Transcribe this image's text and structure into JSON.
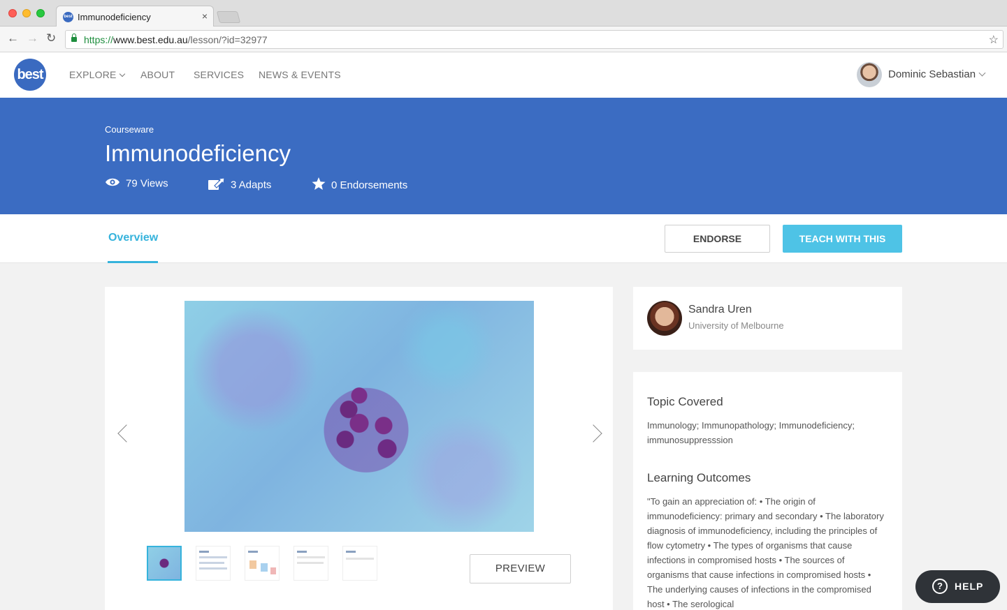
{
  "browser": {
    "tab_title": "Immunodeficiency",
    "tab_close": "×",
    "url_scheme": "https://",
    "url_host": "www.best.edu.au",
    "url_path": "/lesson/?id=32977"
  },
  "header": {
    "logo_text": "best",
    "nav": {
      "explore": "EXPLORE",
      "about": "ABOUT",
      "services": "SERVICES",
      "news": "NEWS & EVENTS"
    },
    "user_name": "Dominic Sebastian"
  },
  "banner": {
    "breadcrumb": "Courseware",
    "title": "Immunodeficiency",
    "views": "79 Views",
    "adapts": "3 Adapts",
    "endorsements": "0 Endorsements"
  },
  "tabs": {
    "overview": "Overview",
    "endorse": "ENDORSE",
    "teach": "TEACH WITH THIS"
  },
  "gallery": {
    "preview": "PREVIEW",
    "thumbnails": [
      "slide-1",
      "slide-2",
      "slide-3",
      "slide-4",
      "slide-5"
    ],
    "selected_index": 0
  },
  "author": {
    "name": "Sandra Uren",
    "org": "University of Melbourne"
  },
  "info": {
    "topic_heading": "Topic Covered",
    "topic_text": "Immunology; Immunopathology; Immunodeficiency; immunosuppresssion",
    "outcomes_heading": "Learning Outcomes",
    "outcomes_text": "\"To gain an appreciation of: • The origin of immunodeficiency: primary and secondary • The laboratory diagnosis of immunodeficiency, including the principles of flow cytometry • The types of organisms that cause infections in compromised hosts • The sources of organisms that cause infections in compromised hosts • The underlying causes of infections in the compromised host • The serological"
  },
  "help": {
    "label": "HELP",
    "icon_glyph": "?"
  },
  "colors": {
    "banner": "#3b6cc2",
    "accent": "#36b3dc",
    "teach_button": "#4ec3e6",
    "help_bg": "#2f3338"
  }
}
